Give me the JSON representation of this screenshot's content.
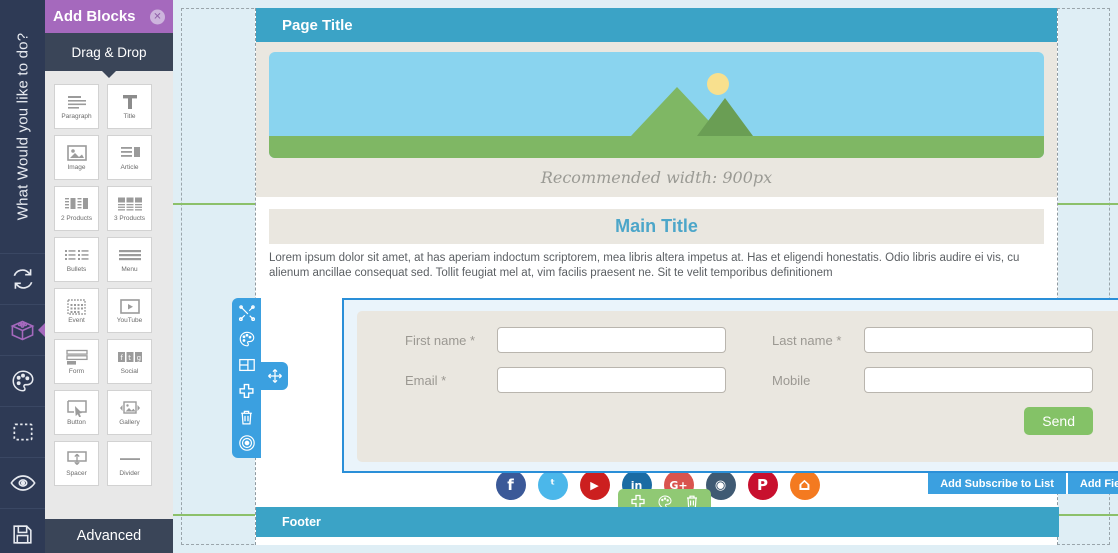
{
  "rail": {
    "question": "What Would you like to do?",
    "icons": [
      {
        "name": "sync-icon",
        "active": false
      },
      {
        "name": "blocks-icon",
        "active": true
      },
      {
        "name": "palette-icon",
        "active": false
      },
      {
        "name": "dashed-frame-icon",
        "active": false
      },
      {
        "name": "eye-icon",
        "active": false
      },
      {
        "name": "save-icon",
        "active": false
      }
    ]
  },
  "panel": {
    "title": "Add Blocks",
    "close_label": "✕",
    "tab": "Drag & Drop",
    "advanced_label": "Advanced",
    "blocks": [
      {
        "label": "Paragraph",
        "icon": "paragraph-icon"
      },
      {
        "label": "Title",
        "icon": "title-icon"
      },
      {
        "label": "Image",
        "icon": "image-icon"
      },
      {
        "label": "Article",
        "icon": "article-icon"
      },
      {
        "label": "2 Products",
        "icon": "two-products-icon"
      },
      {
        "label": "3 Products",
        "icon": "three-products-icon"
      },
      {
        "label": "Bullets",
        "icon": "bullets-icon"
      },
      {
        "label": "Menu",
        "icon": "menu-icon"
      },
      {
        "label": "Event",
        "icon": "event-icon"
      },
      {
        "label": "YouTube",
        "icon": "youtube-icon"
      },
      {
        "label": "Form",
        "icon": "form-icon"
      },
      {
        "label": "Social",
        "icon": "social-icon"
      },
      {
        "label": "Button",
        "icon": "button-icon"
      },
      {
        "label": "Gallery",
        "icon": "gallery-icon"
      },
      {
        "label": "Spacer",
        "icon": "spacer-icon"
      },
      {
        "label": "Divider",
        "icon": "divider-icon"
      }
    ]
  },
  "page": {
    "page_title": "Page Title",
    "hero_note": "Recommended width: 900px",
    "main_title": "Main Title",
    "body_copy": "Lorem ipsum dolor sit amet, at has aperiam indoctum scriptorem, mea libris altera impetus at. Has et eligendi honestatis. Odio libris audire ei vis, cu alienum ancillae consequat sed. Tollit feugiat mel at, vim facilis praesent ne. Sit te velit temporibus definitionem",
    "footer_title": "Footer"
  },
  "form": {
    "fields": [
      {
        "label": "First name *",
        "value": "",
        "name": "first-name-input"
      },
      {
        "label": "Last name *",
        "value": "",
        "name": "last-name-input"
      },
      {
        "label": "Email *",
        "value": "",
        "name": "email-input"
      },
      {
        "label": "Mobile",
        "value": "",
        "name": "mobile-input"
      }
    ],
    "send_label": "Send",
    "action_subscribe": "Add Subscribe to List",
    "action_add_field": "Add Field",
    "tools": [
      {
        "name": "settings-tools-icon"
      },
      {
        "name": "palette-icon"
      },
      {
        "name": "layout-icon"
      },
      {
        "name": "add-icon"
      },
      {
        "name": "trash-icon"
      },
      {
        "name": "target-icon"
      }
    ],
    "move_handle": "move-handle-icon"
  },
  "social": [
    {
      "name": "facebook-icon",
      "glyph": "f",
      "color": "#3b5998"
    },
    {
      "name": "twitter-icon",
      "glyph": "ᵗ",
      "color": "#4bb7ea"
    },
    {
      "name": "youtube-icon",
      "glyph": "▶",
      "color": "#cc1f1f"
    },
    {
      "name": "linkedin-icon",
      "glyph": "in",
      "color": "#1a6ba3"
    },
    {
      "name": "googleplus-icon",
      "glyph": "G+",
      "color": "#d9544e"
    },
    {
      "name": "instagram-icon",
      "glyph": "◉",
      "color": "#3f5a73"
    },
    {
      "name": "pinterest-icon",
      "glyph": "P",
      "color": "#c8102e"
    },
    {
      "name": "home-icon",
      "glyph": "⌂",
      "color": "#f47a20"
    }
  ],
  "footer_tools": [
    {
      "name": "add-icon"
    },
    {
      "name": "palette-icon"
    },
    {
      "name": "trash-icon"
    }
  ],
  "colors": {
    "rail_bg": "#2e3a55",
    "panel_accent": "#a569bd",
    "page_bar": "#3ba3c6",
    "selected_border": "#2a8fd8",
    "action_blue": "#3ba0e0",
    "send_green": "#84c267",
    "guide_green": "#8cc06a",
    "canvas_bg": "#dfeef5",
    "block_bg": "#eae7e0"
  }
}
